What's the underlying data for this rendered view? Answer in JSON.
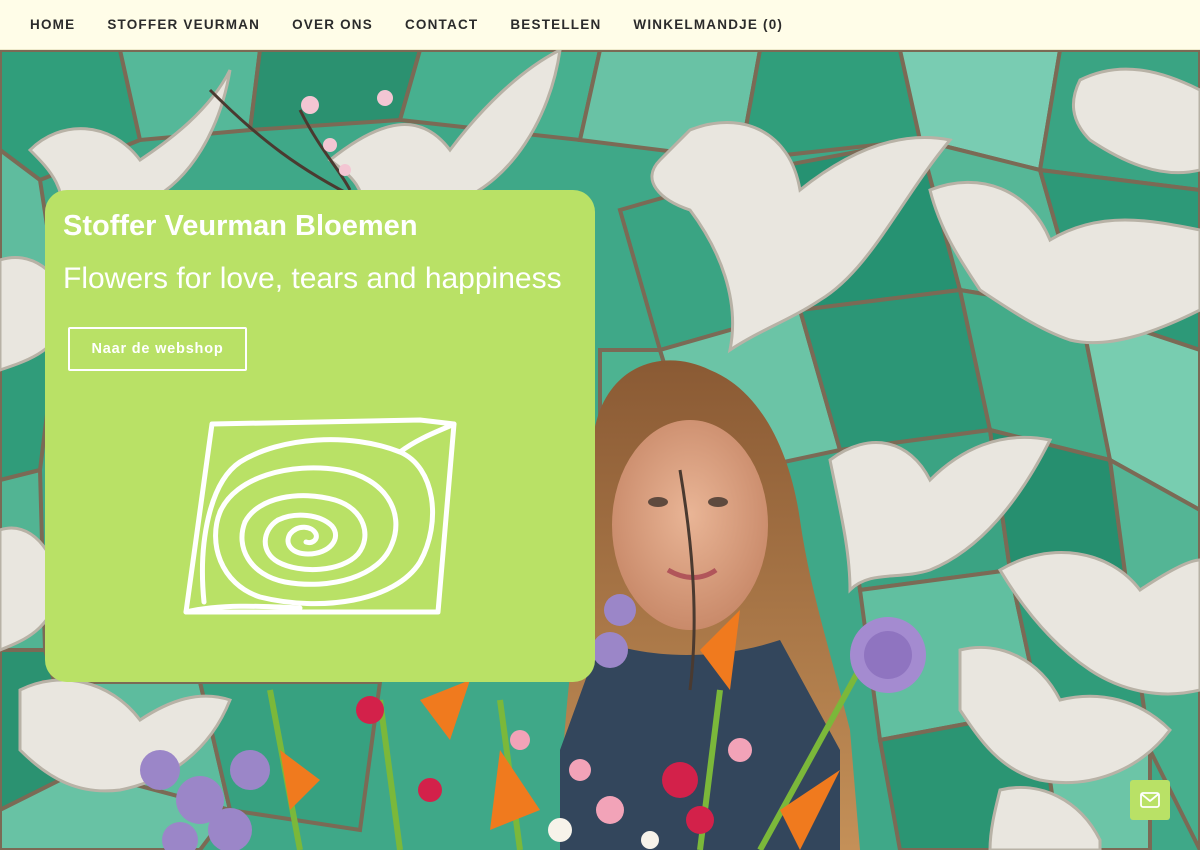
{
  "nav": {
    "items": [
      {
        "label": "HOME"
      },
      {
        "label": "STOFFER VEURMAN"
      },
      {
        "label": "OVER ONS"
      },
      {
        "label": "CONTACT"
      },
      {
        "label": "BESTELLEN"
      },
      {
        "label": "WINKELMANDJE (0)"
      }
    ]
  },
  "hero": {
    "title": "Stoffer Veurman Bloemen",
    "subtitle": "Flowers for love, tears and happiness",
    "cta_label": "Naar de webshop",
    "logo_icon": "rose-line-logo",
    "background_image": "woman-with-flower-bouquet-in-front-of-mosaic-dove-wall"
  },
  "floating": {
    "mail_icon": "mail-icon"
  },
  "colors": {
    "nav_background": "#fffde8",
    "accent_green": "#b9e166",
    "text_white": "#ffffff",
    "nav_text": "#2b2b2b"
  }
}
